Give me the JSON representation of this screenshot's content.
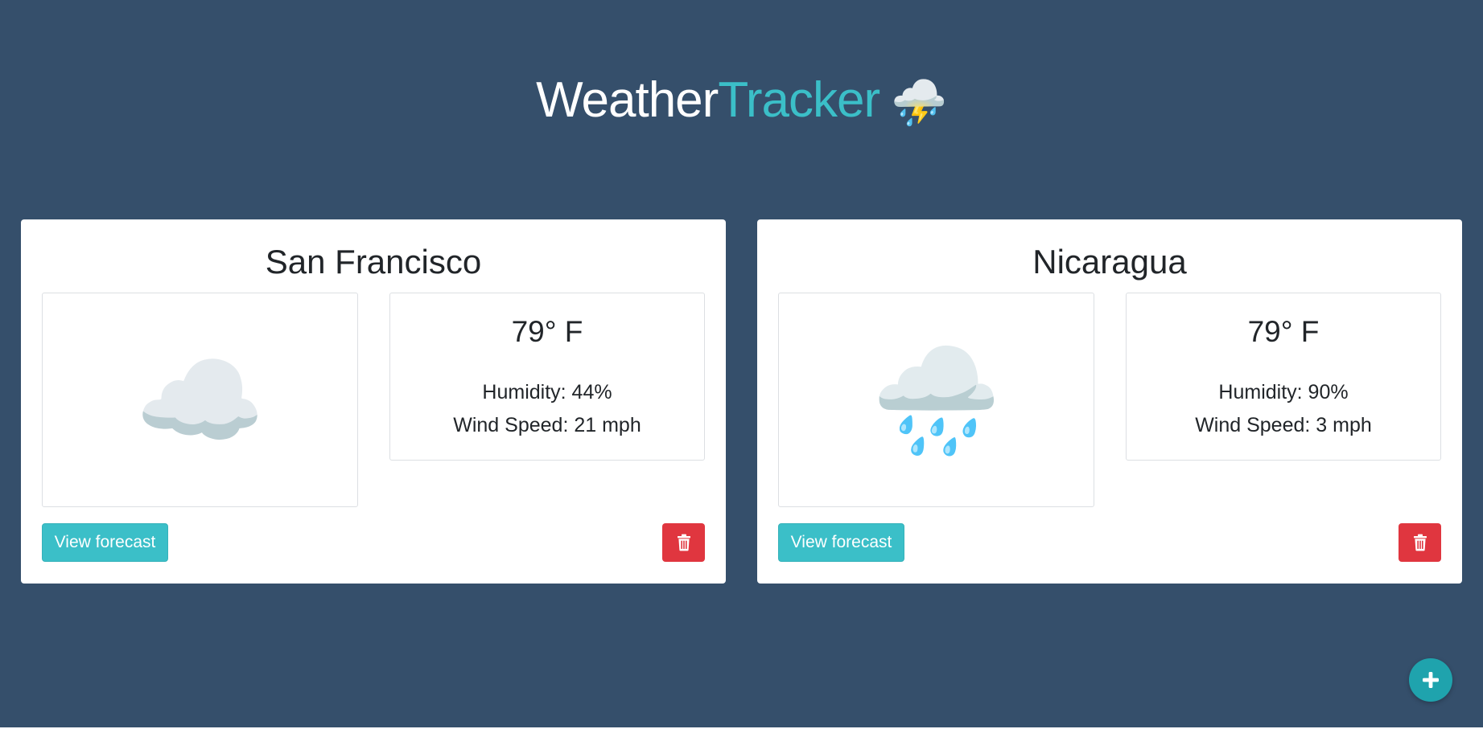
{
  "header": {
    "title_part1": "Weather",
    "title_part2": "Tracker",
    "title_emoji": "⛈️"
  },
  "colors": {
    "background": "#354f6b",
    "accent": "#3bbfc8",
    "danger": "#e0363f"
  },
  "cards": [
    {
      "city": "San Francisco",
      "icon": "cloud-icon",
      "icon_glyph": "☁️",
      "temperature": "79° F",
      "humidity": "Humidity: 44%",
      "wind": "Wind Speed: 21 mph",
      "forecast_label": "View forecast",
      "delete_icon": "trash-icon"
    },
    {
      "city": "Nicaragua",
      "icon": "rain-cloud-icon",
      "icon_glyph": "🌧️",
      "temperature": "79° F",
      "humidity": "Humidity: 90%",
      "wind": "Wind Speed: 3 mph",
      "forecast_label": "View forecast",
      "delete_icon": "trash-icon"
    }
  ],
  "add_button": {
    "icon": "plus-icon"
  }
}
